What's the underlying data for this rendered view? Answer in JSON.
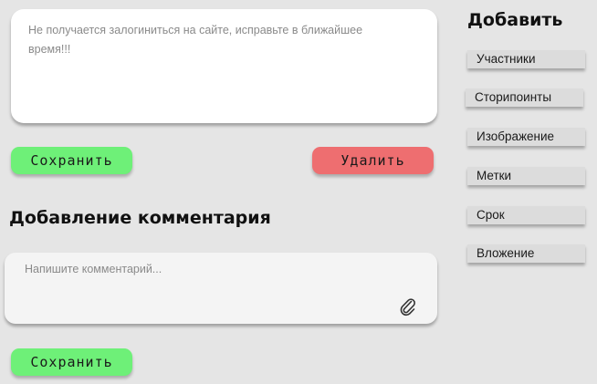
{
  "task": {
    "description": "Не получается залогиниться на сайте, исправьте в ближайшее время!!!",
    "save_label": "Сохранить",
    "delete_label": "Удалить"
  },
  "comments": {
    "heading": "Добавление комментария",
    "placeholder": "Напишите комментарий...",
    "attach_icon": "paperclip-icon",
    "save_label": "Сохранить"
  },
  "sidebar": {
    "heading": "Добавить",
    "items": [
      {
        "label": "Участники"
      },
      {
        "label": "Сторипоинты"
      },
      {
        "label": "Изображение"
      },
      {
        "label": "Метки"
      },
      {
        "label": "Срок"
      },
      {
        "label": "Вложение"
      }
    ]
  },
  "colors": {
    "background": "#e5e5e5",
    "save_button": "#6ef078",
    "delete_button": "#ee6e70",
    "side_button": "#dcdcdc"
  }
}
